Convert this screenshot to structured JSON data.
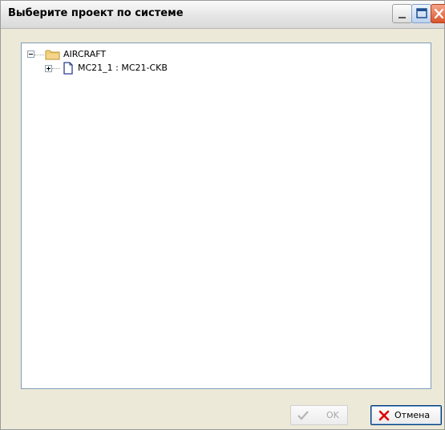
{
  "window": {
    "title": "Выберите проект по системе",
    "controls": {
      "minimize": "minimize-icon",
      "maximize": "maximize-icon",
      "close": "close-icon"
    }
  },
  "tree": {
    "items": [
      {
        "label": "AIRCRAFT",
        "icon": "folder-icon",
        "expanded": true
      },
      {
        "label": "MC21_1 : MC21-CKB",
        "icon": "document-icon",
        "expanded": false
      }
    ]
  },
  "buttons": {
    "ok": {
      "label": "OK",
      "icon": "checkmark-icon",
      "enabled": false
    },
    "cancel": {
      "label": "Отмена",
      "icon": "x-icon",
      "enabled": true
    }
  },
  "colors": {
    "window_bg": "#ece9d8",
    "tree_border": "#7f9db9",
    "close_red": "#d9542c",
    "cancel_x": "#e00000",
    "disabled_text": "#a8a8a8"
  }
}
